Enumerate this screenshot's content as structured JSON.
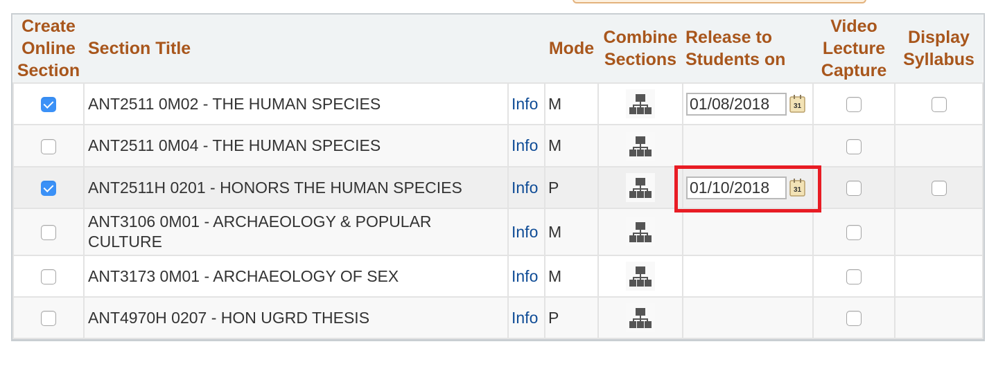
{
  "headers": {
    "create_online_section": [
      "Create",
      "Online",
      "Section"
    ],
    "section_title": "Section Title",
    "info": "",
    "mode": "Mode",
    "combine_sections": [
      "Combine",
      "Sections"
    ],
    "release_to_students": [
      "Release to",
      "Students on"
    ],
    "video_lecture_capture": [
      "Video",
      "Lecture",
      "Capture"
    ],
    "display_syllabus": [
      "Display",
      "Syllabus"
    ]
  },
  "colors": {
    "header_text": "#a8561c",
    "link": "#0f4c96",
    "checkbox_checked": "#3b91f7",
    "highlight_border": "#e81c24"
  },
  "rows": [
    {
      "create_checked": true,
      "title": "ANT2511  0M02 - THE HUMAN SPECIES",
      "info": "Info",
      "mode": "M",
      "combine_icon": "combine-sections-icon",
      "release_date": "01/08/2018",
      "has_date": true,
      "video_checked": false,
      "syllabus_visible": true,
      "syllabus_checked": false
    },
    {
      "create_checked": false,
      "title": "ANT2511  0M04 - THE HUMAN SPECIES",
      "info": "Info",
      "mode": "M",
      "combine_icon": "combine-sections-icon",
      "release_date": "",
      "has_date": false,
      "video_checked": false,
      "syllabus_visible": false,
      "syllabus_checked": false
    },
    {
      "create_checked": true,
      "title": "ANT2511H 0201 - HONORS THE HUMAN SPECIES",
      "info": "Info",
      "mode": "P",
      "combine_icon": "combine-sections-icon",
      "release_date": "01/10/2018",
      "has_date": true,
      "video_checked": false,
      "syllabus_visible": true,
      "syllabus_checked": false,
      "highlighted": true
    },
    {
      "create_checked": false,
      "title": "ANT3106  0M01 - ARCHAEOLOGY & POPULAR CULTURE",
      "info": "Info",
      "mode": "M",
      "combine_icon": "combine-sections-icon",
      "release_date": "",
      "has_date": false,
      "video_checked": false,
      "syllabus_visible": false,
      "syllabus_checked": false
    },
    {
      "create_checked": false,
      "title": "ANT3173  0M01 - ARCHAEOLOGY OF SEX",
      "info": "Info",
      "mode": "M",
      "combine_icon": "combine-sections-icon",
      "release_date": "",
      "has_date": false,
      "video_checked": false,
      "syllabus_visible": false,
      "syllabus_checked": false
    },
    {
      "create_checked": false,
      "title": "ANT4970H 0207 - HON UGRD THESIS",
      "info": "Info",
      "mode": "P",
      "combine_icon": "combine-sections-icon",
      "release_date": "",
      "has_date": false,
      "video_checked": false,
      "syllabus_visible": false,
      "syllabus_checked": false
    }
  ]
}
